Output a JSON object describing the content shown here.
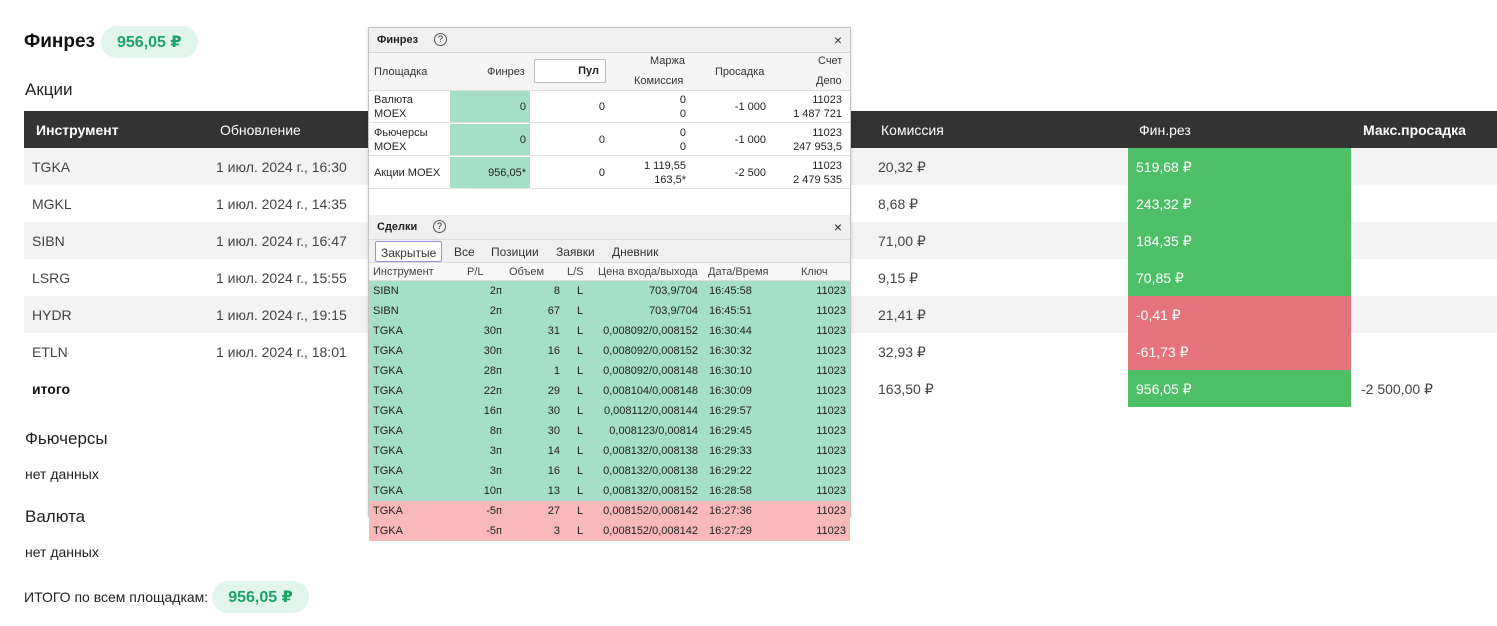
{
  "header": {
    "title": "Финрез",
    "total": "956,05 ₽"
  },
  "stocks": {
    "title": "Акции",
    "columns": [
      "Инструмент",
      "Обновление",
      "Комиссия",
      "Фин.рез",
      "Макс.просадка"
    ],
    "rows": [
      {
        "ticker": "TGKA",
        "updated": "1 июл. 2024 г., 16:30",
        "commission": "20,32 ₽",
        "finres": "519,68 ₽",
        "sign": "pos"
      },
      {
        "ticker": "MGKL",
        "updated": "1 июл. 2024 г., 14:35",
        "commission": "8,68 ₽",
        "finres": "243,32 ₽",
        "sign": "pos"
      },
      {
        "ticker": "SIBN",
        "updated": "1 июл. 2024 г., 16:47",
        "commission": "71,00 ₽",
        "finres": "184,35 ₽",
        "sign": "pos"
      },
      {
        "ticker": "LSRG",
        "updated": "1 июл. 2024 г., 15:55",
        "commission": "9,15 ₽",
        "finres": "70,85 ₽",
        "sign": "pos"
      },
      {
        "ticker": "HYDR",
        "updated": "1 июл. 2024 г., 19:15",
        "commission": "21,41 ₽",
        "finres": "-0,41 ₽",
        "sign": "neg"
      },
      {
        "ticker": "ETLN",
        "updated": "1 июл. 2024 г., 18:01",
        "commission": "32,93 ₽",
        "finres": "-61,73 ₽",
        "sign": "neg"
      }
    ],
    "total": {
      "label": "итого",
      "commission": "163,50 ₽",
      "finres": "956,05 ₽",
      "drawdown": "-2 500,00 ₽"
    }
  },
  "futures": {
    "title": "Фьючерсы",
    "empty": "нет данных"
  },
  "currency": {
    "title": "Валюта",
    "empty": "нет данных"
  },
  "grand_total": {
    "label": "ИТОГО по всем площадкам:",
    "value": "956,05 ₽"
  },
  "widget": {
    "title": "Финрез",
    "help": "?",
    "close": "×",
    "head": {
      "platform": "Площадка",
      "finres": "Финрез",
      "pul": "Пул",
      "margin": "Маржа",
      "commission": "Комиссия",
      "drawdown": "Просадка",
      "account": "Счет",
      "depo": "Депо"
    },
    "rows": [
      {
        "name1": "Валюта",
        "name2": "MOEX",
        "finres": "0",
        "pul": "0",
        "margin": "0",
        "commission": "0",
        "drawdown": "-1 000",
        "account": "11023",
        "depo": "1 487 721"
      },
      {
        "name1": "Фьючерсы",
        "name2": "MOEX",
        "finres": "0",
        "pul": "0",
        "margin": "0",
        "commission": "0",
        "drawdown": "-1 000",
        "account": "11023",
        "depo": "247 953,5"
      },
      {
        "name1": "Акции MOEX",
        "name2": "",
        "finres": "956,05*",
        "pul": "0",
        "margin": "1 119,55",
        "commission": "163,5*",
        "drawdown": "-2 500",
        "account": "11023",
        "depo": "2 479 535"
      }
    ],
    "deals": {
      "title": "Сделки",
      "tabs": [
        "Закрытые",
        "Все",
        "Позиции",
        "Заявки",
        "Дневник"
      ],
      "columns": [
        "Инструмент",
        "P/L",
        "Объем",
        "L/S",
        "Цена входа/выхода",
        "Дата/Время",
        "Ключ"
      ],
      "rows": [
        {
          "inst": "SIBN",
          "pl": "2п",
          "vol": "8",
          "ls": "L",
          "price": "703,9/704",
          "time": "16:45:58",
          "key": "11023",
          "c": "g"
        },
        {
          "inst": "SIBN",
          "pl": "2п",
          "vol": "67",
          "ls": "L",
          "price": "703,9/704",
          "time": "16:45:51",
          "key": "11023",
          "c": "g"
        },
        {
          "inst": "TGKA",
          "pl": "30п",
          "vol": "31",
          "ls": "L",
          "price": "0,008092/0,008152",
          "time": "16:30:44",
          "key": "11023",
          "c": "g"
        },
        {
          "inst": "TGKA",
          "pl": "30п",
          "vol": "16",
          "ls": "L",
          "price": "0,008092/0,008152",
          "time": "16:30:32",
          "key": "11023",
          "c": "g"
        },
        {
          "inst": "TGKA",
          "pl": "28п",
          "vol": "1",
          "ls": "L",
          "price": "0,008092/0,008148",
          "time": "16:30:10",
          "key": "11023",
          "c": "g"
        },
        {
          "inst": "TGKA",
          "pl": "22п",
          "vol": "29",
          "ls": "L",
          "price": "0,008104/0,008148",
          "time": "16:30:09",
          "key": "11023",
          "c": "g"
        },
        {
          "inst": "TGKA",
          "pl": "16п",
          "vol": "30",
          "ls": "L",
          "price": "0,008112/0,008144",
          "time": "16:29:57",
          "key": "11023",
          "c": "g"
        },
        {
          "inst": "TGKA",
          "pl": "8п",
          "vol": "30",
          "ls": "L",
          "price": "0,008123/0,00814",
          "time": "16:29:45",
          "key": "11023",
          "c": "g"
        },
        {
          "inst": "TGKA",
          "pl": "3п",
          "vol": "14",
          "ls": "L",
          "price": "0,008132/0,008138",
          "time": "16:29:33",
          "key": "11023",
          "c": "g"
        },
        {
          "inst": "TGKA",
          "pl": "3п",
          "vol": "16",
          "ls": "L",
          "price": "0,008132/0,008138",
          "time": "16:29:22",
          "key": "11023",
          "c": "g"
        },
        {
          "inst": "TGKA",
          "pl": "10п",
          "vol": "13",
          "ls": "L",
          "price": "0,008132/0,008152",
          "time": "16:28:58",
          "key": "11023",
          "c": "g"
        },
        {
          "inst": "TGKA",
          "pl": "-5п",
          "vol": "27",
          "ls": "L",
          "price": "0,008152/0,008142",
          "time": "16:27:36",
          "key": "11023",
          "c": "r"
        },
        {
          "inst": "TGKA",
          "pl": "-5п",
          "vol": "3",
          "ls": "L",
          "price": "0,008152/0,008142",
          "time": "16:27:29",
          "key": "11023",
          "c": "r"
        }
      ]
    }
  },
  "colors": {
    "positive": "#4fbf67",
    "negative": "#e5737b",
    "deal_profit": "#a6dfc8",
    "deal_loss": "#f9b8b9",
    "header_dark": "#333333",
    "pill_bg": "#e2f5ed",
    "pill_text": "#1da36a"
  }
}
